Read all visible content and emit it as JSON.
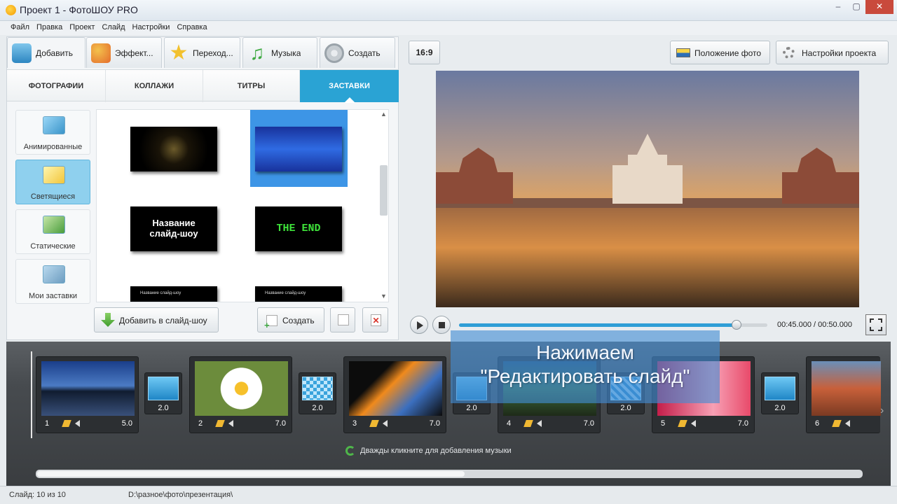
{
  "window": {
    "title": "Проект 1 - ФотоШОУ PRO",
    "controls": [
      "–",
      "▢",
      "✕"
    ]
  },
  "menu": [
    "Файл",
    "Правка",
    "Проект",
    "Слайд",
    "Настройки",
    "Справка"
  ],
  "top_tabs": [
    {
      "label": "Добавить",
      "icon": "add-photo-icon"
    },
    {
      "label": "Эффект...",
      "icon": "palette-icon"
    },
    {
      "label": "Переход...",
      "icon": "star-icon"
    },
    {
      "label": "Музыка",
      "icon": "music-note-icon"
    },
    {
      "label": "Создать",
      "icon": "film-reel-icon"
    }
  ],
  "sub_tabs": [
    "ФОТОГРАФИИ",
    "КОЛЛАЖИ",
    "ТИТРЫ",
    "ЗАСТАВКИ"
  ],
  "categories": [
    "Анимированные",
    "Светящиеся",
    "Статические",
    "Мои заставки"
  ],
  "gallery": {
    "t3": [
      "Название",
      "слайд-шоу"
    ],
    "t4": "THE END",
    "t5": "Название слайд-шоу",
    "t6": "Название слайд-шоу"
  },
  "left_buttons": {
    "add": "Добавить в слайд-шоу",
    "create": "Создать"
  },
  "right_toolbar": {
    "ratio": "16:9",
    "photo_position": "Положение фото",
    "project_settings": "Настройки проекта"
  },
  "player": {
    "time": "00:45.000 / 00:50.000",
    "progress": 0.9
  },
  "slides": [
    {
      "num": "1",
      "dur": "5.0"
    },
    {
      "num": "2",
      "dur": "7.0"
    },
    {
      "num": "3",
      "dur": "7.0"
    },
    {
      "num": "4",
      "dur": "7.0"
    },
    {
      "num": "5",
      "dur": "7.0"
    },
    {
      "num": "6",
      "dur": ""
    }
  ],
  "transitions": [
    "2.0",
    "2.0",
    "2.0",
    "2.0",
    "2.0"
  ],
  "music_hint": "Дважды кликните для добавления музыки",
  "overlay": [
    "Нажимаем",
    "\"Редактировать слайд\""
  ],
  "status": {
    "slide": "Слайд: 10 из 10",
    "path": "D:\\разное\\фото\\презентация\\"
  },
  "colors": {
    "accent": "#2aa3d4",
    "selected_category": "#8fd0ee"
  }
}
